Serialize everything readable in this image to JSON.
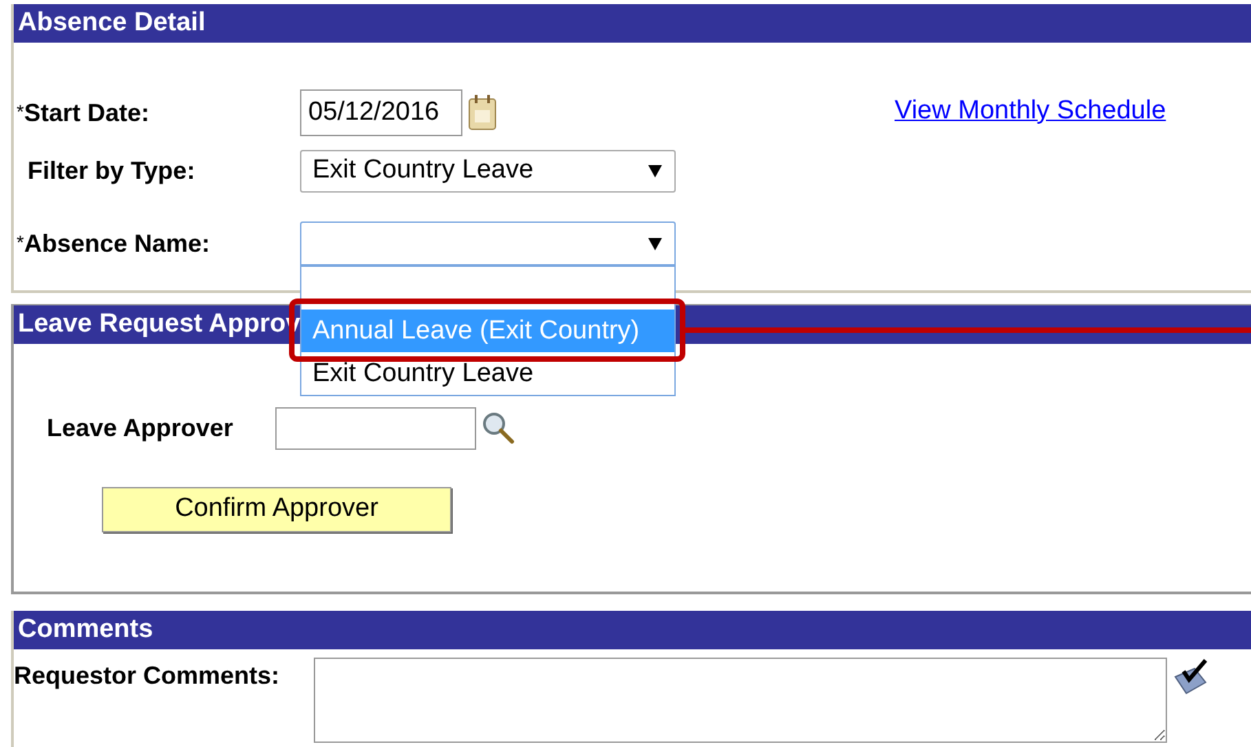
{
  "absence_detail": {
    "title": "Absence Detail",
    "start_date": {
      "marker": "*",
      "label": "Start Date:",
      "value": "05/12/2016"
    },
    "link": "View Monthly Schedule",
    "filter_by_type": {
      "label": "Filter by Type:",
      "value": "Exit Country Leave"
    },
    "absence_name": {
      "marker": "*",
      "label": "Absence Name:",
      "expanded": true,
      "options": [
        {
          "kind": "text",
          "label": "Annual Leave (Exit Country)",
          "selected": true
        },
        {
          "kind": "text",
          "label": "Exit Country Leave",
          "selected": false
        }
      ]
    }
  },
  "leave_request_approval": {
    "title": "Leave Request Approv",
    "approver_label": "Leave Approver",
    "button": "Confirm Approver"
  },
  "comments": {
    "title": "Comments",
    "label": "Requestor Comments:"
  }
}
